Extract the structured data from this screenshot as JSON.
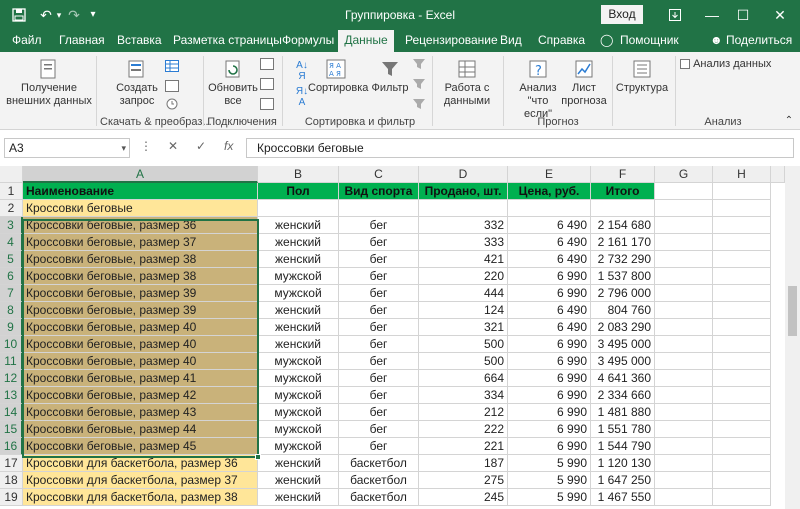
{
  "titlebar": {
    "save_icon": "save-icon",
    "undo_icon": "undo-icon",
    "redo_icon": "redo-icon",
    "title": "Группировка  -  Excel",
    "signin": "Вход",
    "bg": "#217346"
  },
  "tabs": [
    "Файл",
    "Главная",
    "Вставка",
    "Разметка страницы",
    "Формулы",
    "Данные",
    "Рецензирование",
    "Вид",
    "Справка",
    "Помощник",
    "Поделиться"
  ],
  "ribbon": {
    "get_data": "Получение\nвнешних данных",
    "create_query": "Создать\nзапрос",
    "group1": "Скачать & преобраз...",
    "refresh_all": "Обновить\nвсе",
    "group2": "Подключения",
    "sort": "Сортировка",
    "filter": "Фильтр",
    "group3": "Сортировка и фильтр",
    "data_tools": "Работа с\nданными",
    "whatif": "Анализ \"что\nесли\"",
    "forecast_sheet": "Лист\nпрогноза",
    "group4": "Прогноз",
    "outline": "Структура",
    "data_analysis": "Анализ данных",
    "group5": "Анализ"
  },
  "formula_bar": {
    "name_box": "A3",
    "cancel": "✕",
    "enter": "✓",
    "fx": "fx",
    "value": "Кроссовки беговые"
  },
  "columns": [
    "A",
    "B",
    "C",
    "D",
    "E",
    "F",
    "G",
    "H"
  ],
  "header_row": [
    "Наименование",
    "Пол",
    "Вид спорта",
    "Продано, шт.",
    "Цена, руб.",
    "Итого"
  ],
  "rows": [
    {
      "n": "2",
      "a": "Кроссовки беговые",
      "b": "",
      "c": "",
      "d": "",
      "e": "",
      "f": ""
    },
    {
      "n": "3",
      "a": "Кроссовки беговые, размер 36",
      "b": "женский",
      "c": "бег",
      "d": "332",
      "e": "6 490",
      "f": "2 154 680"
    },
    {
      "n": "4",
      "a": "Кроссовки беговые, размер 37",
      "b": "женский",
      "c": "бег",
      "d": "333",
      "e": "6 490",
      "f": "2 161 170"
    },
    {
      "n": "5",
      "a": "Кроссовки беговые, размер 38",
      "b": "женский",
      "c": "бег",
      "d": "421",
      "e": "6 490",
      "f": "2 732 290"
    },
    {
      "n": "6",
      "a": "Кроссовки беговые, размер 38",
      "b": "мужской",
      "c": "бег",
      "d": "220",
      "e": "6 990",
      "f": "1 537 800"
    },
    {
      "n": "7",
      "a": "Кроссовки беговые, размер 39",
      "b": "мужской",
      "c": "бег",
      "d": "444",
      "e": "6 990",
      "f": "2 796 000"
    },
    {
      "n": "8",
      "a": "Кроссовки беговые, размер 39",
      "b": "женский",
      "c": "бег",
      "d": "124",
      "e": "6 490",
      "f": "804 760"
    },
    {
      "n": "9",
      "a": "Кроссовки беговые, размер 40",
      "b": "женский",
      "c": "бег",
      "d": "321",
      "e": "6 490",
      "f": "2 083 290"
    },
    {
      "n": "10",
      "a": "Кроссовки беговые, размер 40",
      "b": "женский",
      "c": "бег",
      "d": "500",
      "e": "6 990",
      "f": "3 495 000"
    },
    {
      "n": "11",
      "a": "Кроссовки беговые, размер 40",
      "b": "мужской",
      "c": "бег",
      "d": "500",
      "e": "6 990",
      "f": "3 495 000"
    },
    {
      "n": "12",
      "a": "Кроссовки беговые, размер 41",
      "b": "мужской",
      "c": "бег",
      "d": "664",
      "e": "6 990",
      "f": "4 641 360"
    },
    {
      "n": "13",
      "a": "Кроссовки беговые, размер 42",
      "b": "мужской",
      "c": "бег",
      "d": "334",
      "e": "6 990",
      "f": "2 334 660"
    },
    {
      "n": "14",
      "a": "Кроссовки беговые, размер 43",
      "b": "мужской",
      "c": "бег",
      "d": "212",
      "e": "6 990",
      "f": "1 481 880"
    },
    {
      "n": "15",
      "a": "Кроссовки беговые, размер 44",
      "b": "мужской",
      "c": "бег",
      "d": "222",
      "e": "6 990",
      "f": "1 551 780"
    },
    {
      "n": "16",
      "a": "Кроссовки беговые, размер 45",
      "b": "мужской",
      "c": "бег",
      "d": "221",
      "e": "6 990",
      "f": "1 544 790"
    },
    {
      "n": "17",
      "a": "Кроссовки для баскетбола, размер 36",
      "b": "женский",
      "c": "баскетбол",
      "d": "187",
      "e": "5 990",
      "f": "1 120 130"
    },
    {
      "n": "18",
      "a": "Кроссовки для баскетбола, размер 37",
      "b": "женский",
      "c": "баскетбол",
      "d": "275",
      "e": "5 990",
      "f": "1 647 250"
    },
    {
      "n": "19",
      "a": "Кроссовки для баскетбола, размер 38",
      "b": "женский",
      "c": "баскетбол",
      "d": "245",
      "e": "5 990",
      "f": "1 467 550"
    }
  ],
  "colors": {
    "header_green": "#00b050",
    "yellow": "#ffe699",
    "selected_tan": "#c9b27a",
    "accent": "#217346"
  }
}
